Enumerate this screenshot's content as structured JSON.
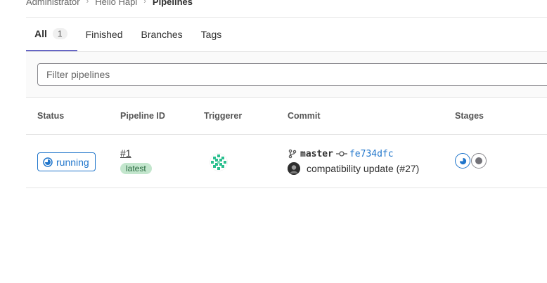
{
  "breadcrumb": {
    "items": [
      "Administrator",
      "Hello Hapi",
      "Pipelines"
    ],
    "separator": ">"
  },
  "tabs": [
    {
      "label": "All",
      "count": "1",
      "active": true
    },
    {
      "label": "Finished"
    },
    {
      "label": "Branches"
    },
    {
      "label": "Tags"
    }
  ],
  "filter": {
    "placeholder": "Filter pipelines"
  },
  "table": {
    "headers": [
      "Status",
      "Pipeline ID",
      "Triggerer",
      "Commit",
      "Stages"
    ],
    "rows": [
      {
        "status": "running",
        "pipeline_id": "#1",
        "badge": "latest",
        "triggerer_icon": "identicon-avatar",
        "branch": "master",
        "sha": "fe734dfc",
        "commit_title": "compatibility update (#27)",
        "stages": [
          "running",
          "pending"
        ]
      }
    ]
  },
  "colors": {
    "accent": "#6666c4",
    "running": "#1f75cb",
    "latest_bg": "#c3e6cd",
    "latest_text": "#24663b",
    "avatar_green": "#2bbf8f"
  }
}
